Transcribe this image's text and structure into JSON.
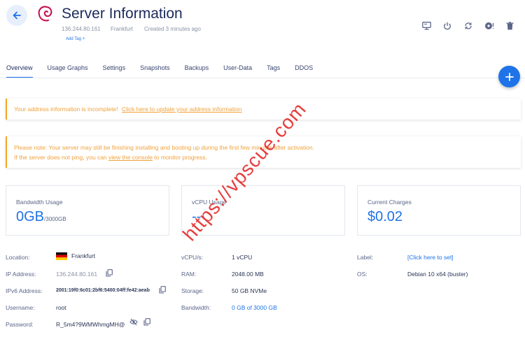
{
  "header": {
    "title": "Server Information",
    "ip": "136.244.80.161",
    "location": "Frankfurt",
    "created": "Created 3 minutes ago",
    "add_tag": "Add Tag +"
  },
  "tabs": [
    {
      "label": "Overview",
      "active": true
    },
    {
      "label": "Usage Graphs"
    },
    {
      "label": "Settings"
    },
    {
      "label": "Snapshots"
    },
    {
      "label": "Backups"
    },
    {
      "label": "User-Data"
    },
    {
      "label": "Tags"
    },
    {
      "label": "DDOS"
    }
  ],
  "alerts": {
    "address_text": "Your address information is incomplete!",
    "address_link": "Click here to update your address information",
    "note_line1": "Please note: Your server may still be finishing installing and booting up during the first few minutes after activation.",
    "note_line2_pre": "If the server does not ping, you can",
    "note_line2_link": "view the console",
    "note_line2_post": "to monitor progress."
  },
  "cards": {
    "bandwidth": {
      "label": "Bandwidth Usage",
      "value": "0GB",
      "suffix": "/3000GB"
    },
    "vcpu": {
      "label": "vCPU Usage",
      "value": "--"
    },
    "charges": {
      "label": "Current Charges",
      "value": "$0.02"
    }
  },
  "info": {
    "location_label": "Location:",
    "location_value": "Frankfurt",
    "ip_label": "IP Address:",
    "ip_value": "136.244.80.161",
    "ipv6_label": "IPv6 Address:",
    "ipv6_value": "2001:19f0:6c01:2bf6:5400:04ff:fe42:aeab",
    "username_label": "Username:",
    "username_value": "root",
    "password_label": "Password:",
    "password_value": "R_5m4?9WMWhmgMH@",
    "vcpus_label": "vCPU/s:",
    "vcpus_value": "1 vCPU",
    "ram_label": "RAM:",
    "ram_value": "2048.00 MB",
    "storage_label": "Storage:",
    "storage_value": "50 GB NVMe",
    "bandwidth_label": "Bandwidth:",
    "bandwidth_value": "0 GB of 3000 GB",
    "label_label": "Label:",
    "label_value": "[Click here to set]",
    "os_label": "OS:",
    "os_value": "Debian 10 x64 (buster)"
  },
  "watermark": "https://vpscue.com",
  "colors": {
    "accent": "#1e73e8",
    "warning": "#f0a13a",
    "watermark": "#e42a2a"
  },
  "icons": [
    "back-arrow-icon",
    "debian-logo-icon",
    "console-icon",
    "power-icon",
    "restart-icon",
    "reinstall-icon",
    "trash-icon",
    "plus-icon",
    "copy-icon",
    "eye-slash-icon",
    "germany-flag-icon"
  ]
}
